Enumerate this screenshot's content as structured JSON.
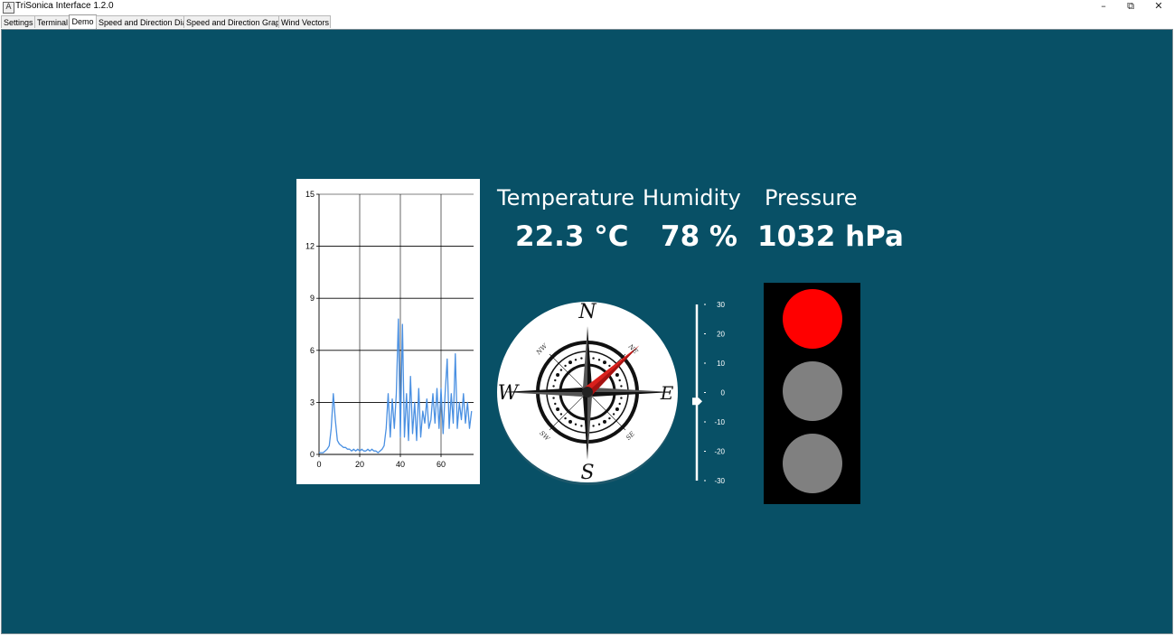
{
  "window": {
    "title": "TriSonica Interface 1.2.0",
    "icon": "app-logo-icon",
    "controls": [
      "minimize-icon",
      "restore-icon",
      "close-icon"
    ]
  },
  "tabs": [
    {
      "label": "Settings",
      "active": false
    },
    {
      "label": "Terminal",
      "active": false
    },
    {
      "label": "Demo",
      "active": true
    },
    {
      "label": "Speed and Direction Dial",
      "active": false
    },
    {
      "label": "Speed and Direction Graph",
      "active": false
    },
    {
      "label": "Wind Vectors",
      "active": false
    }
  ],
  "readings": {
    "temperature": {
      "label": "Temperature",
      "value": "22.3 °C"
    },
    "humidity": {
      "label": "Humidity",
      "value": "78 %"
    },
    "pressure": {
      "label": "Pressure",
      "value": "1032 hPa"
    }
  },
  "compass": {
    "cardinals": {
      "n": "N",
      "e": "E",
      "s": "S",
      "w": "W"
    },
    "intercardinals": {
      "ne": "NE",
      "se": "SE",
      "sw": "SW",
      "nw": "NW"
    },
    "needle_heading_deg": 48,
    "needle_color": "#d9201c"
  },
  "scale": {
    "tick_labels": [
      "30",
      "20",
      "10",
      "0",
      "-10",
      "-20",
      "-30"
    ],
    "range": [
      -30,
      30
    ],
    "value": -3
  },
  "traffic_light": {
    "active": "red",
    "colors": {
      "on": "#ff0000",
      "off": "#808080"
    }
  },
  "colors": {
    "background": "#085066",
    "series": "#4a90e2"
  },
  "chart_data": {
    "type": "line",
    "title": "",
    "xlabel": "",
    "ylabel": "",
    "xlim": [
      0,
      76
    ],
    "ylim": [
      0,
      15
    ],
    "xticks": [
      0,
      20,
      40,
      60
    ],
    "yticks": [
      0,
      3,
      6,
      9,
      12,
      15
    ],
    "grid": true,
    "series": [
      {
        "x": [
          0,
          1,
          2,
          3,
          4,
          5,
          6,
          7,
          8,
          9,
          10,
          11,
          12,
          13,
          14,
          15,
          16,
          17,
          18,
          19,
          20,
          21,
          22,
          23,
          24,
          25,
          26,
          27,
          28,
          29,
          30,
          31,
          32,
          33,
          34,
          35,
          36,
          37,
          38,
          39,
          40,
          41,
          42,
          43,
          44,
          45,
          46,
          47,
          48,
          49,
          50,
          51,
          52,
          53,
          54,
          55,
          56,
          57,
          58,
          59,
          60,
          61,
          62,
          63,
          64,
          65,
          66,
          67,
          68,
          69,
          70,
          71,
          72,
          73,
          74,
          75
        ],
        "y": [
          0.1,
          0.1,
          0.1,
          0.2,
          0.3,
          0.5,
          1.5,
          3.5,
          2.0,
          0.8,
          0.6,
          0.5,
          0.4,
          0.4,
          0.3,
          0.3,
          0.2,
          0.3,
          0.2,
          0.3,
          0.2,
          0.3,
          0.2,
          0.2,
          0.3,
          0.2,
          0.3,
          0.2,
          0.2,
          0.1,
          0.2,
          0.3,
          0.5,
          1.5,
          3.5,
          1.0,
          3.2,
          1.5,
          3.5,
          7.8,
          1.0,
          7.5,
          1.0,
          3.5,
          0.8,
          4.5,
          1.2,
          3.0,
          0.8,
          3.8,
          1.0,
          2.5,
          1.8,
          3.2,
          1.5,
          2.0,
          3.5,
          1.8,
          3.8,
          1.5,
          3.8,
          1.2,
          3.5,
          5.5,
          1.5,
          3.5,
          1.8,
          5.8,
          1.5,
          3.0,
          2.0,
          3.5,
          1.8,
          3.0,
          1.5,
          2.5
        ]
      }
    ]
  }
}
